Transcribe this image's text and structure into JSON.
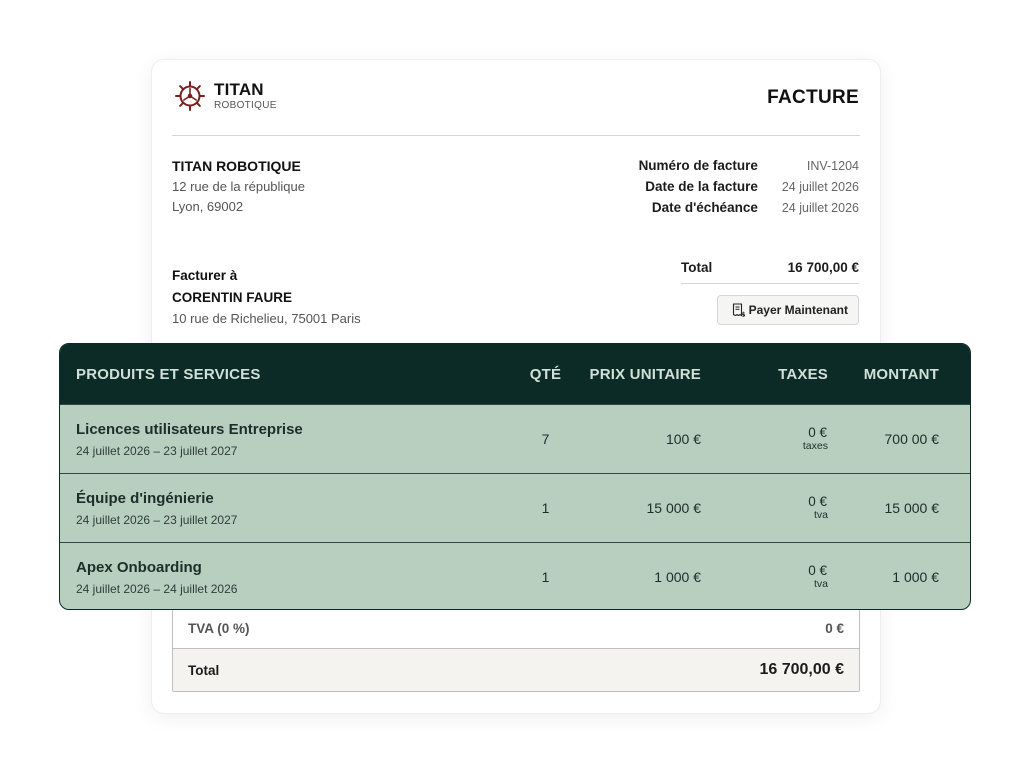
{
  "brand": {
    "name": "TITAN",
    "sub": "ROBOTIQUE",
    "accent": "#7a1f1f",
    "dark_green": "#0c2a26",
    "light_green": "#b8cfbf"
  },
  "invoice": {
    "title": "FACTURE",
    "company": {
      "name": "TITAN ROBOTIQUE",
      "address1": "12 rue de la république",
      "address2": "Lyon, 69002"
    },
    "meta": [
      {
        "label": "Numéro de facture",
        "value": "INV-1204"
      },
      {
        "label": "Date de la facture",
        "value": "24 juillet 2026"
      },
      {
        "label": "Date d'échéance",
        "value": "24 juillet 2026"
      }
    ],
    "bill_to": {
      "label": "Facturer à",
      "name": "CORENTIN FAURE",
      "address": "10 rue de Richelieu, 75001 Paris"
    },
    "total_top": {
      "label": "Total",
      "value": "16 700,00 €"
    },
    "pay_button": {
      "label": "Payer Maintenant",
      "icon": "receipt-icon"
    }
  },
  "items_table": {
    "headers": {
      "product": "PRODUITS ET SERVICES",
      "qty": "QTÉ",
      "unit_price": "PRIX UNITAIRE",
      "taxes": "TAXES",
      "amount": "MONTANT"
    },
    "rows": [
      {
        "title": "Licences utilisateurs Entreprise",
        "period": "24 juillet 2026 – 23 juillet 2027",
        "qty": "7",
        "unit_price": "100 €",
        "tax": "0 €",
        "tax_note": "taxes",
        "amount": "700 00 €"
      },
      {
        "title": "Équipe d'ingénierie",
        "period": "24 juillet 2026 – 23 juillet 2027",
        "qty": "1",
        "unit_price": "15 000 €",
        "tax": "0 €",
        "tax_note": "tva",
        "amount": "15 000 €"
      },
      {
        "title": "Apex Onboarding",
        "period": "24 juillet 2026 – 24 juillet 2026",
        "qty": "1",
        "unit_price": "1 000 €",
        "tax": "0 €",
        "tax_note": "tva",
        "amount": "1 000 €"
      }
    ]
  },
  "summary": {
    "vat": {
      "label": "TVA (0 %)",
      "value": "0 €"
    },
    "total": {
      "label": "Total",
      "value": "16 700,00 €"
    }
  }
}
